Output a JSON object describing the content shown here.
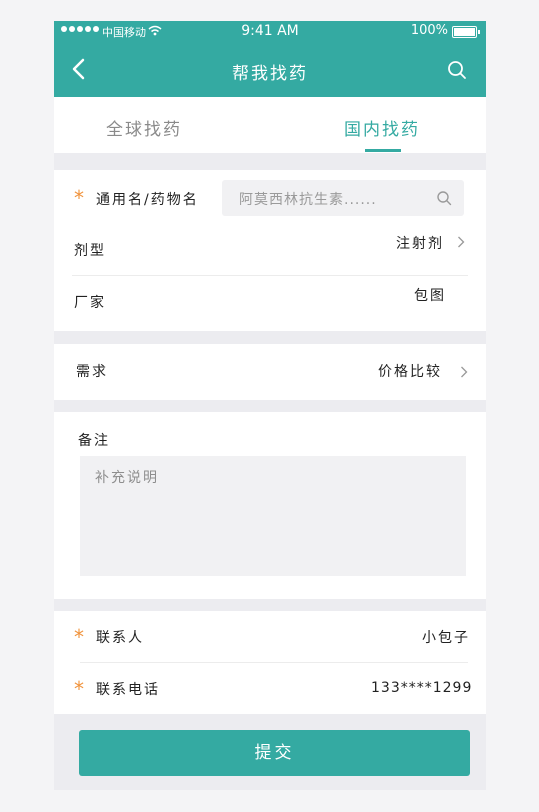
{
  "status_bar": {
    "carrier": "中国移动",
    "time": "9:41 AM",
    "battery": "100%"
  },
  "header": {
    "title": "帮我找药"
  },
  "tabs": [
    {
      "label": "全球找药"
    },
    {
      "label": "国内找药"
    }
  ],
  "form": {
    "drug_name": {
      "label": "通用名/药物名",
      "placeholder": "阿莫西林抗生素......"
    },
    "dosage_form": {
      "label": "剂型",
      "value": "注射剂"
    },
    "manufacturer": {
      "label": "厂家",
      "value": "包图"
    },
    "demand": {
      "label": "需求",
      "value": "价格比较"
    },
    "remark": {
      "label": "备注",
      "placeholder": "补充说明"
    },
    "contact": {
      "label": "联系人",
      "value": "小包子"
    },
    "phone": {
      "label": "联系电话",
      "value": "133****1299"
    }
  },
  "submit_label": "提交",
  "colors": {
    "accent": "#34aaa2",
    "required_star": "#f0923b"
  }
}
